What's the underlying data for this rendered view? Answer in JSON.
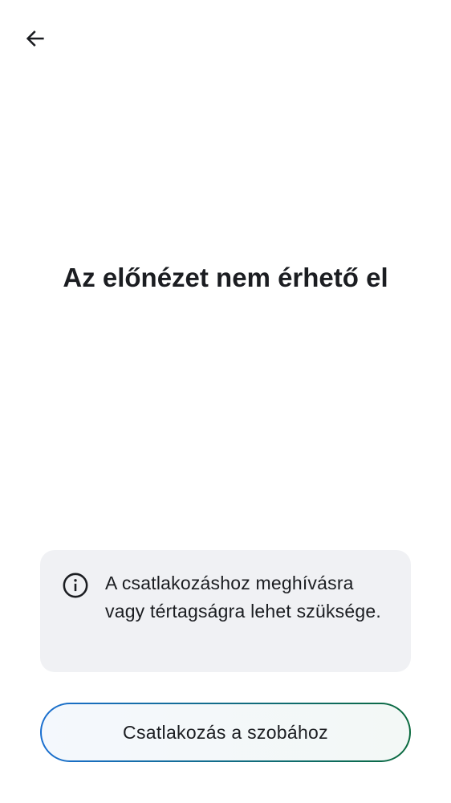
{
  "header": {
    "back_icon": "arrow-left-icon"
  },
  "main": {
    "title": "Az előnézet nem érhető el"
  },
  "notice": {
    "icon": "info-icon",
    "text": "A csatlakozáshoz meghívásra vagy tértagságra lehet szüksége."
  },
  "actions": {
    "join_label": "Csatlakozás a szobához",
    "border_gradient": [
      "#1a6fd0",
      "#0a6a3e"
    ]
  }
}
